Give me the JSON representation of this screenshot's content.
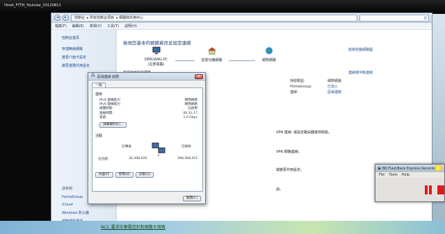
{
  "video": {
    "title": "Hinet_FTTH_Youtube_20120811",
    "subtitle": "NCC 要求中華電信針對網路大頻寬"
  },
  "explorer": {
    "nav_back": "◄",
    "nav_forward": "►",
    "address": [
      "控制台",
      "所有控制台項目",
      "網路和共用中心"
    ],
    "menu": [
      "檔案(F)",
      "編輯(E)",
      "檢視(V)",
      "工具(T)",
      "說明(H)"
    ],
    "sidebar": {
      "home": "控制台首頁",
      "items": [
        "管理無線網路",
        "變更介面卡設定",
        "變更進階共用設定"
      ],
      "see_also_header": "請參閱",
      "see_also": [
        "HomeGroup",
        "iCloud",
        "Windows 防火牆",
        "網際網路選項"
      ]
    },
    "main": {
      "heading": "檢視您基本的網路資訊並設定連線",
      "full_map_link": "檢視完整網路圖",
      "nodes": [
        {
          "label": "DERUANG-PC",
          "sub": "(這部電腦)"
        },
        {
          "label": "岩雲光纖網路",
          "sub": ""
        },
        {
          "label": "網際網路",
          "sub": ""
        }
      ],
      "active_header": "檢視作用中的網路",
      "connect_link": "連線或中斷連線",
      "props": [
        {
          "k": "存取類型:",
          "v": "網際網路",
          "link": false
        },
        {
          "k": "HomeGroup:",
          "v": "已加入",
          "link": true
        },
        {
          "k": "連線:",
          "v": "區域連線",
          "link": true
        }
      ],
      "bg_lines": [
        "VPN 連線; 或設定路由器或存取點。",
        "VPN 網路連線。",
        "或變更共用設定。",
        "說。"
      ]
    }
  },
  "dialog": {
    "title": "區域連線 狀態",
    "close": "x",
    "tab": "一般",
    "conn_header": "連線",
    "conn_rows": [
      {
        "k": "IPv4 連線能力:",
        "v": "網際網路"
      },
      {
        "k": "IPv6 連線能力:",
        "v": "網際網路"
      },
      {
        "k": "媒體狀態:",
        "v": "已啟用"
      },
      {
        "k": "連線時間:",
        "v": "00:31:17"
      },
      {
        "k": "速度:",
        "v": "1.0 Gbps"
      }
    ],
    "details_btn": "詳細資料(E)...",
    "activity_header": "活動",
    "sent_label": "已傳送",
    "recv_label": "已接收",
    "bytes_label": "位元組:",
    "bytes_sent": "34,308,920",
    "bytes_recv": "398,308,415",
    "props_btn": "內容(P)",
    "disable_btn": "停用(D)",
    "diagnose_btn": "診斷(G)",
    "close_btn": "關閉(C)"
  },
  "flashback": {
    "title": "BB FlashBack Express Recorder",
    "menu": [
      "File",
      "Tools",
      "Help"
    ]
  },
  "colors": {
    "accent": "#1a4d8f",
    "record_red": "#e01a1a"
  }
}
